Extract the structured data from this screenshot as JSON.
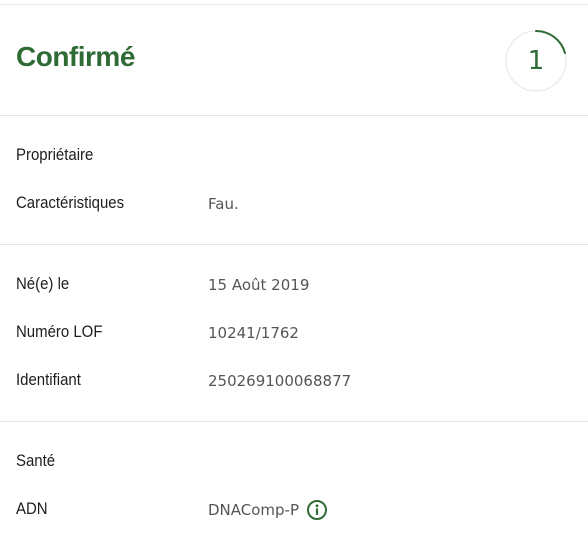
{
  "header": {
    "status": "Confirmé",
    "counter": "1",
    "accent_color": "#2f6b35"
  },
  "section_owner": {
    "owner_label": "Propriétaire",
    "traits_label": "Caractéristiques",
    "traits_value": "Fau."
  },
  "section_identity": {
    "birth_label": "Né(e) le",
    "birth_value": "15 Août 2019",
    "lof_label": "Numéro LOF",
    "lof_value": "10241/1762",
    "id_label": "Identifiant",
    "id_value": "250269100068877"
  },
  "section_health": {
    "health_label": "Santé",
    "dna_label": "ADN",
    "dna_value": "DNAComp-P",
    "info_icon": "info-icon"
  }
}
